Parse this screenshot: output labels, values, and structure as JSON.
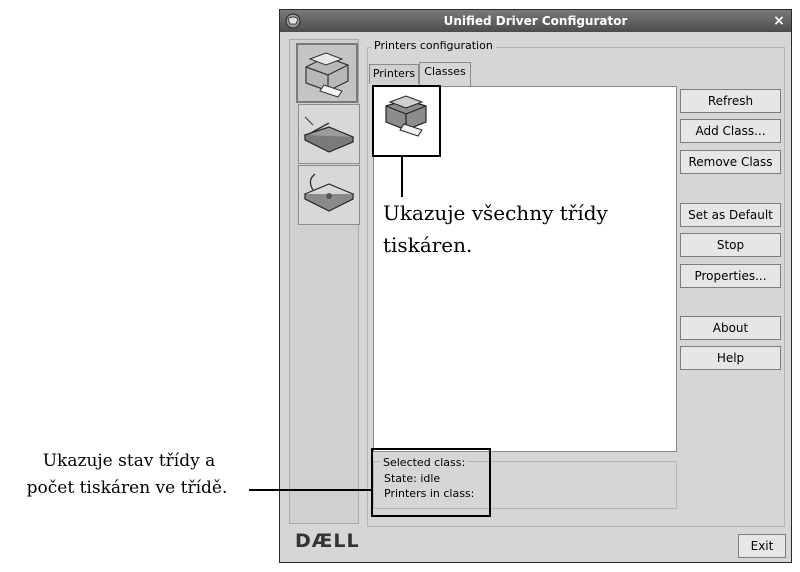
{
  "window": {
    "title": "Unified Driver Configurator",
    "close_glyph": "×"
  },
  "sidebar": {
    "items": [
      {
        "name": "printers-configuration",
        "icon": "printer-icon",
        "active": true
      },
      {
        "name": "scanners-configuration",
        "icon": "scanner-icon",
        "active": false
      },
      {
        "name": "ports-configuration",
        "icon": "port-icon",
        "active": false
      }
    ]
  },
  "group": {
    "title": "Printers configuration",
    "tabs": [
      {
        "label": "Printers",
        "active": false
      },
      {
        "label": "Classes",
        "active": true
      }
    ]
  },
  "buttons": {
    "refresh": "Refresh",
    "add_class": "Add Class...",
    "remove_class": "Remove Class",
    "set_default": "Set as Default",
    "stop": "Stop",
    "properties": "Properties...",
    "about": "About",
    "help": "Help",
    "exit": "Exit"
  },
  "status": {
    "selected": "Selected class:",
    "state": "State: idle",
    "printers": "Printers in class:"
  },
  "logo": "DÆLL",
  "annotations": {
    "classes_note_line1": "Ukazuje všechny třídy",
    "classes_note_line2": "tiskáren.",
    "status_note_line1": "Ukazuje stav třídy a",
    "status_note_line2": "počet tiskáren ve třídě."
  },
  "colors": {
    "titlebar": "#5a5a5a",
    "window_bg": "#d6d6d6",
    "list_bg": "#ffffff"
  }
}
